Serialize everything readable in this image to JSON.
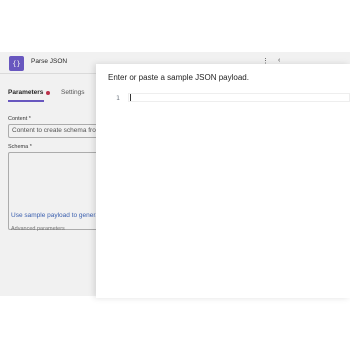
{
  "action": {
    "title": "Parse JSON",
    "icon": "code-braces-icon",
    "icon_glyph": "{}",
    "menu_glyph": "⋮",
    "collapse_glyph": "‹"
  },
  "tabs": [
    {
      "label": "Parameters",
      "active": true,
      "has_error": true
    },
    {
      "label": "Settings",
      "active": false
    }
  ],
  "form": {
    "content_label": "Content *",
    "content_value": "Content to create schema from",
    "schema_label": "Schema *",
    "sample_link": "Use sample payload to generate schema",
    "clipped_text": "Advanced parameters"
  },
  "modal": {
    "title": "Enter or paste a sample JSON payload.",
    "line_number": "1",
    "payload": ""
  },
  "colors": {
    "accent": "#6b58c9",
    "error_dot": "#c4314b",
    "link": "#3a62b8"
  }
}
